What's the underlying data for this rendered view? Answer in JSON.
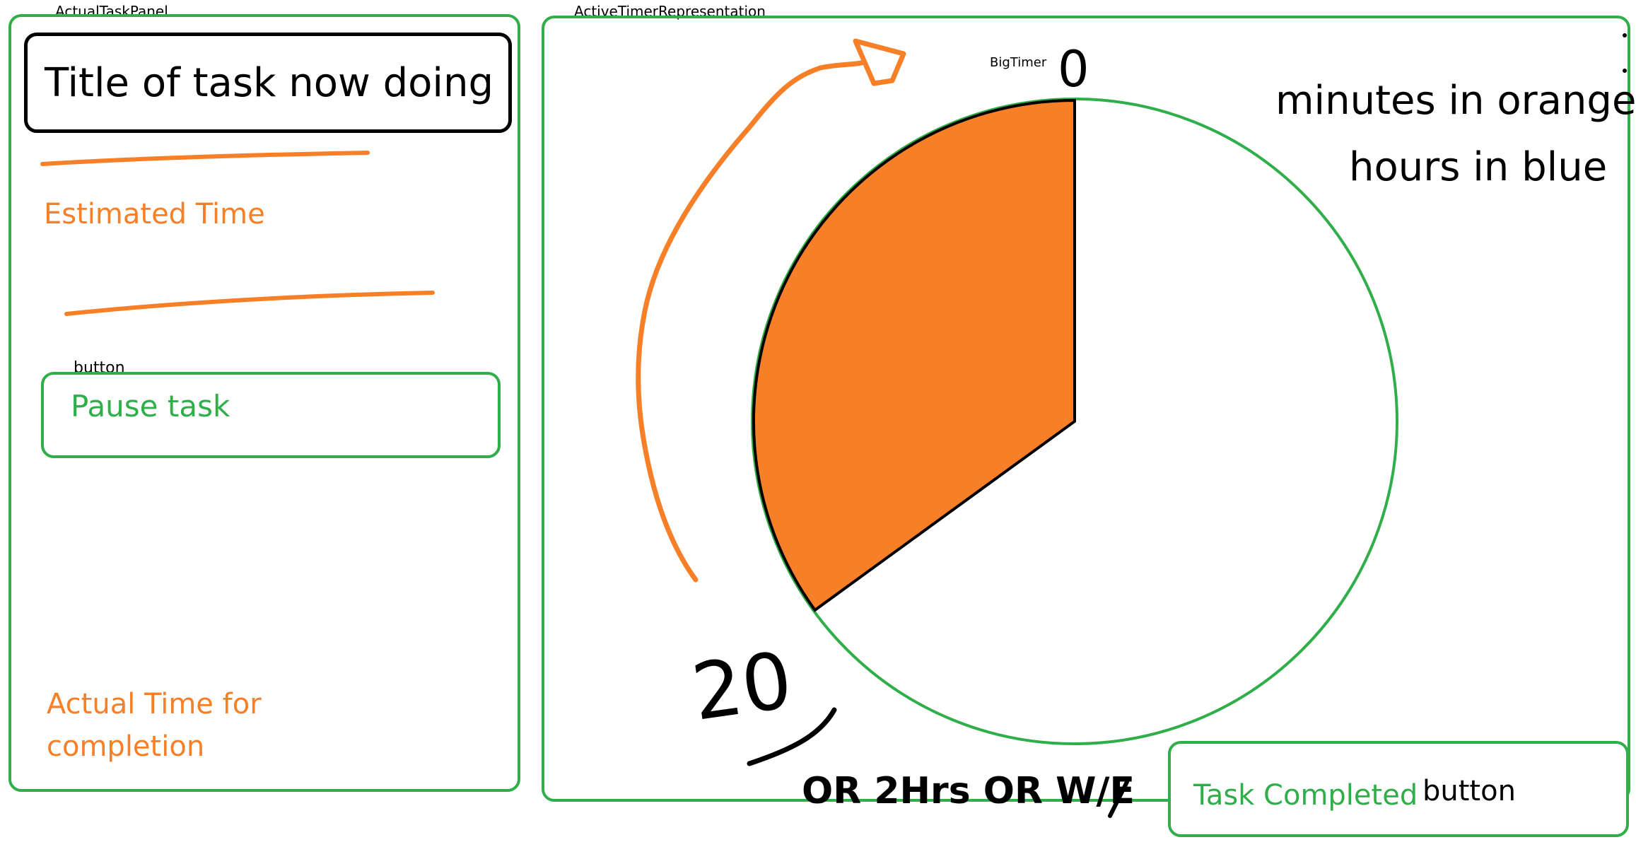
{
  "task_panel": {
    "annotation": "ActualTaskPanel",
    "title": "Title of task now doing",
    "estimated_time_label": "Estimated Time",
    "button_annotation": "button",
    "pause_button_label": "Pause task",
    "actual_time_label_line1": "Actual Time for",
    "actual_time_label_line2": "completion"
  },
  "timer_panel": {
    "annotation": "ActiveTimerRepresentation",
    "bigtimer_annotation": "BigTimer",
    "start_mark": "0",
    "elapsed_mark": "20",
    "alt_units_note": "OR 2Hrs OR W/E",
    "legend_minutes": "minutes in orange",
    "legend_hours": "hours in blue",
    "elapsed_fraction": 0.35,
    "colors": {
      "elapsed": "#f77f28",
      "border": "#2fae4a",
      "sketch": "#f77f28"
    }
  },
  "complete": {
    "button_label": "Task Completed",
    "annotation": "button"
  }
}
